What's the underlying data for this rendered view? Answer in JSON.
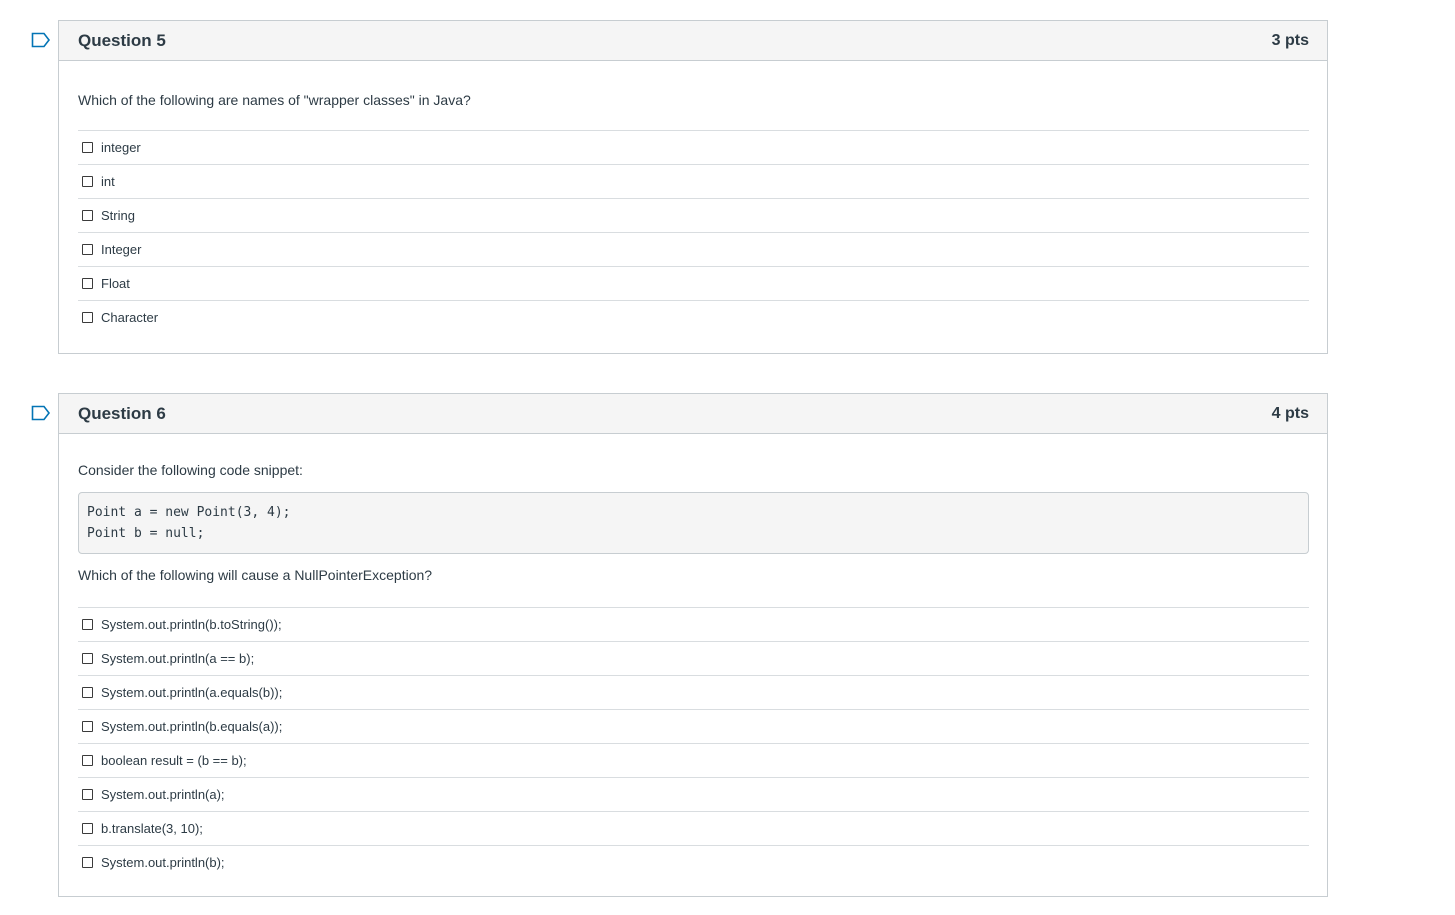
{
  "questions": [
    {
      "title": "Question 5",
      "points": "3 pts",
      "prompt": "Which of the following are names of \"wrapper classes\" in Java?",
      "answers": [
        "integer",
        "int",
        "String",
        "Integer",
        "Float",
        "Character"
      ]
    },
    {
      "title": "Question 6",
      "points": "4 pts",
      "intro": "Consider the following code snippet:",
      "code": [
        "Point a = new Point(3, 4);",
        "Point b = null;"
      ],
      "prompt": "Which of the following will cause a NullPointerException?",
      "answers": [
        "System.out.println(b.toString());",
        "System.out.println(a == b);",
        "System.out.println(a.equals(b));",
        "System.out.println(b.equals(a));",
        "boolean result = (b == b);",
        "System.out.println(a);",
        "b.translate(3, 10);",
        "System.out.println(b);"
      ]
    }
  ],
  "icons": {
    "flag": "flag-icon",
    "checkbox": "checkbox"
  },
  "colors": {
    "text": "#2d3b45",
    "header_bg": "#f5f5f5",
    "border": "#c7cdd1",
    "flag": "#0374b5"
  }
}
